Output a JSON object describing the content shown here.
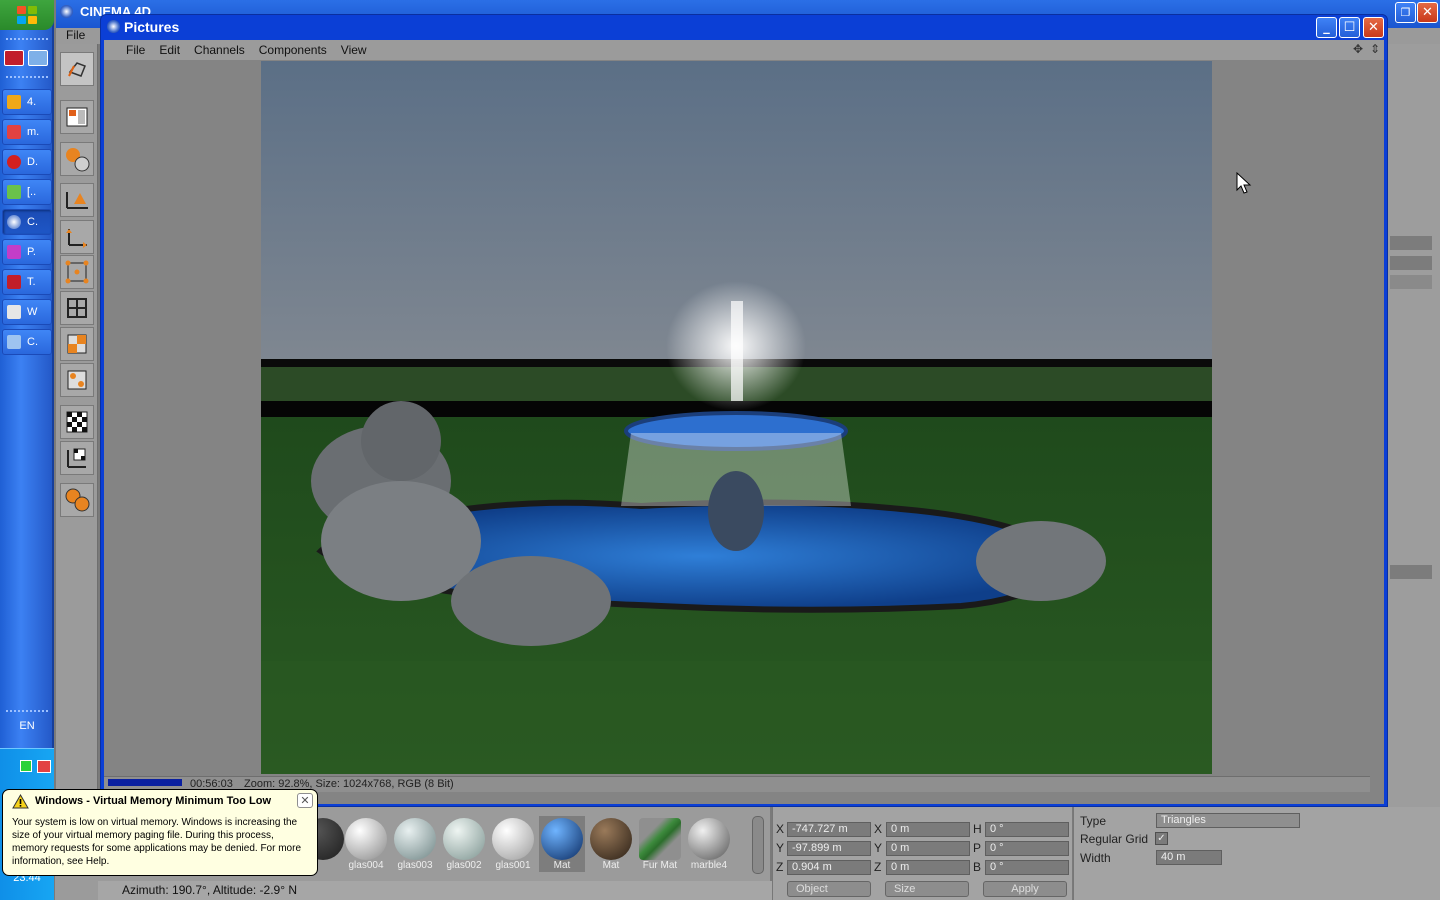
{
  "taskbar": {
    "tasks": [
      {
        "label": "4."
      },
      {
        "label": "m."
      },
      {
        "label": "D."
      },
      {
        "label": "[.."
      },
      {
        "label": "C."
      },
      {
        "label": "P."
      },
      {
        "label": "T."
      },
      {
        "label": "W"
      },
      {
        "label": "C."
      }
    ],
    "language": "EN",
    "clock": "23:44"
  },
  "c4d": {
    "title": "CINEMA 4D",
    "menu_file": "File"
  },
  "pictures_window": {
    "title": "Pictures",
    "menu": [
      "File",
      "Edit",
      "Channels",
      "Components",
      "View"
    ],
    "status_time": "00:56:03",
    "status_info": "Zoom: 92.8%, Size: 1024x768, RGB (8 Bit)"
  },
  "materials": [
    {
      "name": "",
      "color": "#1d1d1d"
    },
    {
      "name": "glas004",
      "color": "#c9c9c9"
    },
    {
      "name": "glas003",
      "color": "#a8b8b8"
    },
    {
      "name": "glas002",
      "color": "#b3c3bf"
    },
    {
      "name": "glas001",
      "color": "#dcdcdc"
    },
    {
      "name": "Mat",
      "color": "#1b5aa0"
    },
    {
      "name": "Mat",
      "color": "#5a4533"
    },
    {
      "name": "Fur Mat",
      "color": "#3d8a3d"
    },
    {
      "name": "marble4",
      "color": "#b6b6b6"
    }
  ],
  "coordinates": {
    "rows": [
      {
        "axis": "X",
        "pos": "-747.727 m",
        "size_axis": "X",
        "size": "0 m",
        "rot_axis": "H",
        "rot": "0 °"
      },
      {
        "axis": "Y",
        "pos": "-97.899 m",
        "size_axis": "Y",
        "size": "0 m",
        "rot_axis": "P",
        "rot": "0 °"
      },
      {
        "axis": "Z",
        "pos": "0.904 m",
        "size_axis": "Z",
        "size": "0 m",
        "rot_axis": "B",
        "rot": "0 °"
      }
    ],
    "mode_select": "Object",
    "size_select": "Size",
    "apply_label": "Apply"
  },
  "attributes": {
    "type_label": "Type",
    "type_value": "Triangles",
    "regular_grid_label": "Regular Grid",
    "regular_grid_checked": true,
    "width_label": "Width",
    "width_value": "40 m"
  },
  "status_line": "Azimuth: 190.7°, Altitude: -2.9°  N",
  "balloon": {
    "title": "Windows - Virtual Memory Minimum Too Low",
    "text": "Your system is low on virtual memory. Windows is increasing the size of your virtual memory paging file. During this process, memory requests for some applications may be denied. For more information, see Help."
  }
}
